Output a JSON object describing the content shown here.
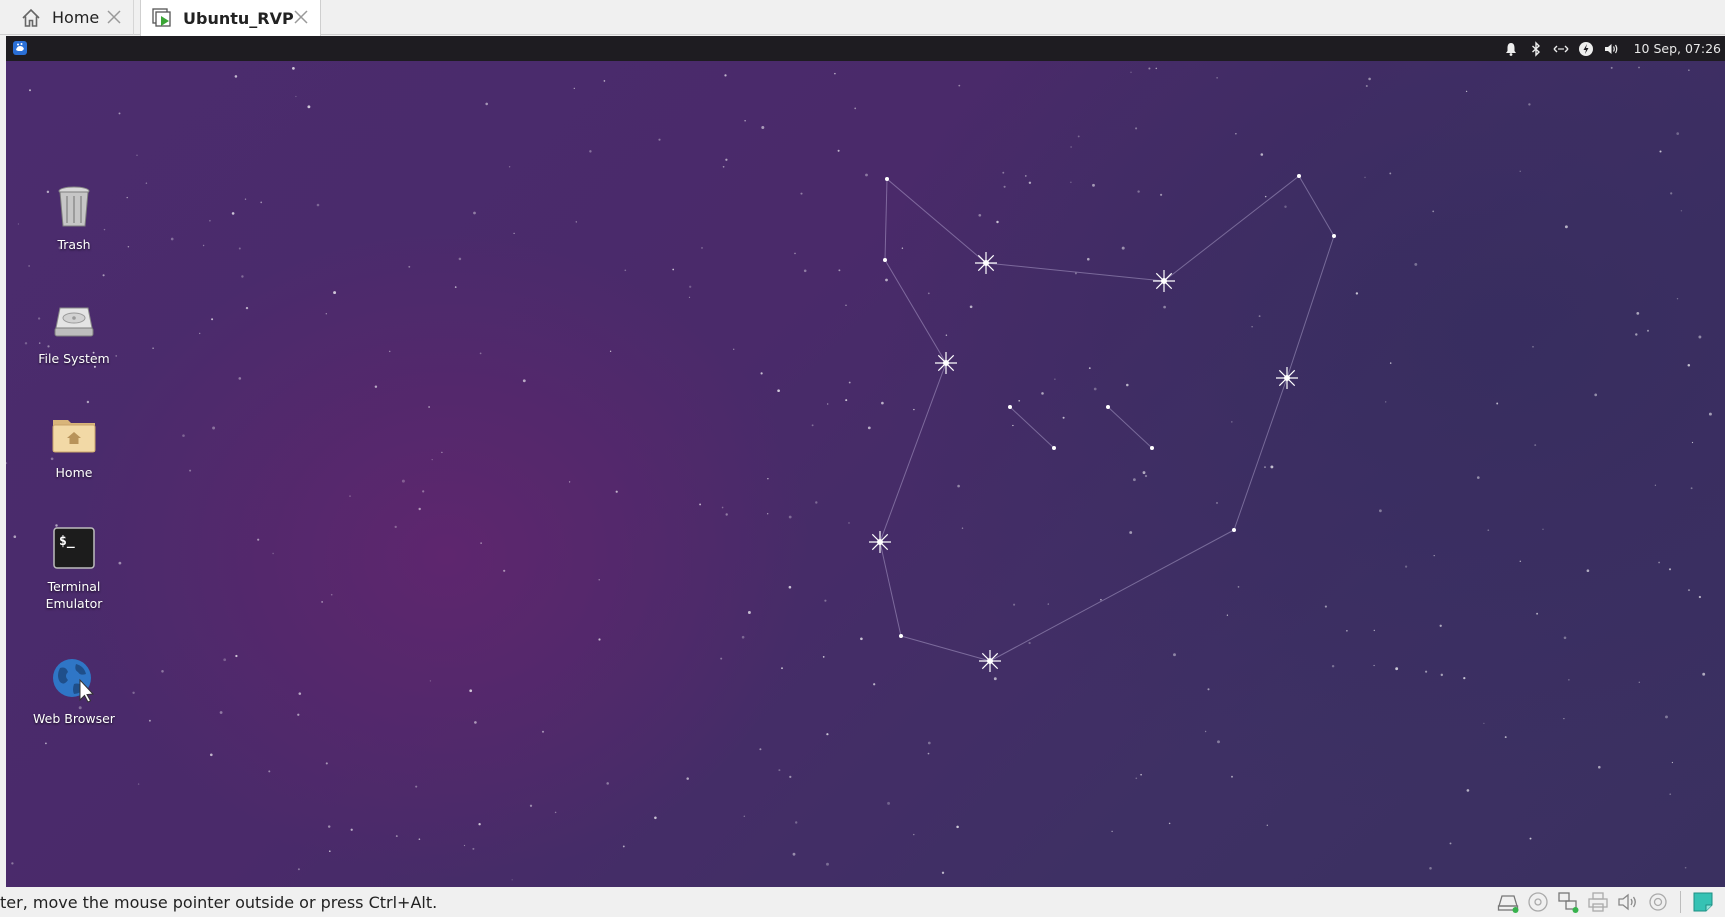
{
  "host": {
    "tabs": [
      {
        "label": "Home",
        "icon": "home-icon",
        "active": false
      },
      {
        "label": "Ubuntu_RVP",
        "icon": "vm-running-icon",
        "active": true
      }
    ],
    "status_text": "ter, move the mouse pointer outside or press Ctrl+Alt.",
    "status_icons": [
      "hard-disk-icon",
      "optical-drive-icon",
      "network-icon",
      "usb-printer-icon",
      "audio-icon",
      "recording-icon",
      "shared-clipboard-icon"
    ]
  },
  "vm": {
    "panel": {
      "menu_icon": "xfce-whisker-icon",
      "tray_icons": [
        "notification-bell-icon",
        "bluetooth-icon",
        "network-arrows-icon",
        "power-icon",
        "volume-icon"
      ],
      "clock": "10 Sep, 07:26"
    },
    "desktop_icons": [
      {
        "label": "Trash",
        "icon": "trash-icon"
      },
      {
        "label": "File System",
        "icon": "drive-icon"
      },
      {
        "label": "Home",
        "icon": "home-folder-icon"
      },
      {
        "label": "Terminal Emulator",
        "icon": "terminal-icon"
      },
      {
        "label": "Web Browser",
        "icon": "web-browser-icon"
      }
    ],
    "colors": {
      "wallpaper_dark": "#3a3060",
      "wallpaper_accent": "#5f266e",
      "panel": "#1e1c21"
    }
  }
}
